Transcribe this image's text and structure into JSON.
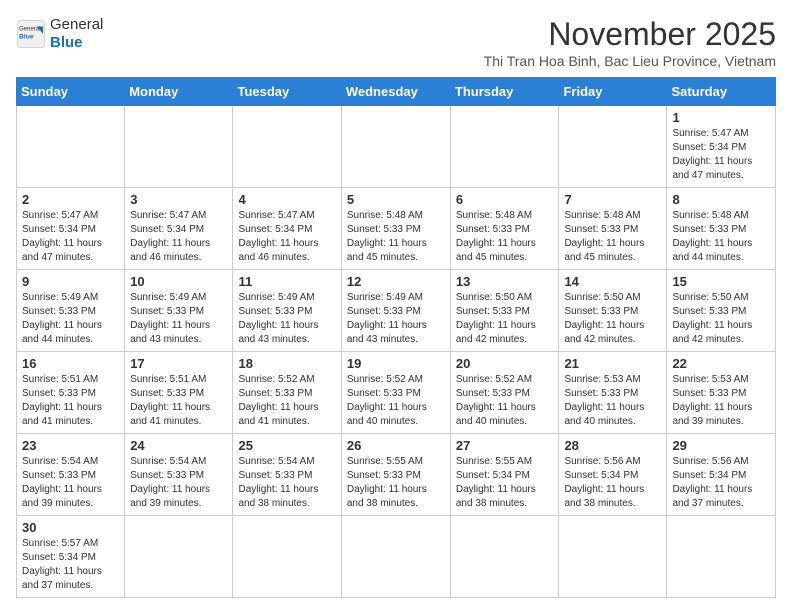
{
  "header": {
    "logo_general": "General",
    "logo_blue": "Blue",
    "month_title": "November 2025",
    "location": "Thi Tran Hoa Binh, Bac Lieu Province, Vietnam"
  },
  "weekdays": [
    "Sunday",
    "Monday",
    "Tuesday",
    "Wednesday",
    "Thursday",
    "Friday",
    "Saturday"
  ],
  "weeks": [
    [
      {
        "day": "",
        "info": ""
      },
      {
        "day": "",
        "info": ""
      },
      {
        "day": "",
        "info": ""
      },
      {
        "day": "",
        "info": ""
      },
      {
        "day": "",
        "info": ""
      },
      {
        "day": "",
        "info": ""
      },
      {
        "day": "1",
        "info": "Sunrise: 5:47 AM\nSunset: 5:34 PM\nDaylight: 11 hours\nand 47 minutes."
      }
    ],
    [
      {
        "day": "2",
        "info": "Sunrise: 5:47 AM\nSunset: 5:34 PM\nDaylight: 11 hours\nand 47 minutes."
      },
      {
        "day": "3",
        "info": "Sunrise: 5:47 AM\nSunset: 5:34 PM\nDaylight: 11 hours\nand 46 minutes."
      },
      {
        "day": "4",
        "info": "Sunrise: 5:47 AM\nSunset: 5:34 PM\nDaylight: 11 hours\nand 46 minutes."
      },
      {
        "day": "5",
        "info": "Sunrise: 5:48 AM\nSunset: 5:33 PM\nDaylight: 11 hours\nand 45 minutes."
      },
      {
        "day": "6",
        "info": "Sunrise: 5:48 AM\nSunset: 5:33 PM\nDaylight: 11 hours\nand 45 minutes."
      },
      {
        "day": "7",
        "info": "Sunrise: 5:48 AM\nSunset: 5:33 PM\nDaylight: 11 hours\nand 45 minutes."
      },
      {
        "day": "8",
        "info": "Sunrise: 5:48 AM\nSunset: 5:33 PM\nDaylight: 11 hours\nand 44 minutes."
      }
    ],
    [
      {
        "day": "9",
        "info": "Sunrise: 5:49 AM\nSunset: 5:33 PM\nDaylight: 11 hours\nand 44 minutes."
      },
      {
        "day": "10",
        "info": "Sunrise: 5:49 AM\nSunset: 5:33 PM\nDaylight: 11 hours\nand 43 minutes."
      },
      {
        "day": "11",
        "info": "Sunrise: 5:49 AM\nSunset: 5:33 PM\nDaylight: 11 hours\nand 43 minutes."
      },
      {
        "day": "12",
        "info": "Sunrise: 5:49 AM\nSunset: 5:33 PM\nDaylight: 11 hours\nand 43 minutes."
      },
      {
        "day": "13",
        "info": "Sunrise: 5:50 AM\nSunset: 5:33 PM\nDaylight: 11 hours\nand 42 minutes."
      },
      {
        "day": "14",
        "info": "Sunrise: 5:50 AM\nSunset: 5:33 PM\nDaylight: 11 hours\nand 42 minutes."
      },
      {
        "day": "15",
        "info": "Sunrise: 5:50 AM\nSunset: 5:33 PM\nDaylight: 11 hours\nand 42 minutes."
      }
    ],
    [
      {
        "day": "16",
        "info": "Sunrise: 5:51 AM\nSunset: 5:33 PM\nDaylight: 11 hours\nand 41 minutes."
      },
      {
        "day": "17",
        "info": "Sunrise: 5:51 AM\nSunset: 5:33 PM\nDaylight: 11 hours\nand 41 minutes."
      },
      {
        "day": "18",
        "info": "Sunrise: 5:52 AM\nSunset: 5:33 PM\nDaylight: 11 hours\nand 41 minutes."
      },
      {
        "day": "19",
        "info": "Sunrise: 5:52 AM\nSunset: 5:33 PM\nDaylight: 11 hours\nand 40 minutes."
      },
      {
        "day": "20",
        "info": "Sunrise: 5:52 AM\nSunset: 5:33 PM\nDaylight: 11 hours\nand 40 minutes."
      },
      {
        "day": "21",
        "info": "Sunrise: 5:53 AM\nSunset: 5:33 PM\nDaylight: 11 hours\nand 40 minutes."
      },
      {
        "day": "22",
        "info": "Sunrise: 5:53 AM\nSunset: 5:33 PM\nDaylight: 11 hours\nand 39 minutes."
      }
    ],
    [
      {
        "day": "23",
        "info": "Sunrise: 5:54 AM\nSunset: 5:33 PM\nDaylight: 11 hours\nand 39 minutes."
      },
      {
        "day": "24",
        "info": "Sunrise: 5:54 AM\nSunset: 5:33 PM\nDaylight: 11 hours\nand 39 minutes."
      },
      {
        "day": "25",
        "info": "Sunrise: 5:54 AM\nSunset: 5:33 PM\nDaylight: 11 hours\nand 38 minutes."
      },
      {
        "day": "26",
        "info": "Sunrise: 5:55 AM\nSunset: 5:33 PM\nDaylight: 11 hours\nand 38 minutes."
      },
      {
        "day": "27",
        "info": "Sunrise: 5:55 AM\nSunset: 5:34 PM\nDaylight: 11 hours\nand 38 minutes."
      },
      {
        "day": "28",
        "info": "Sunrise: 5:56 AM\nSunset: 5:34 PM\nDaylight: 11 hours\nand 38 minutes."
      },
      {
        "day": "29",
        "info": "Sunrise: 5:56 AM\nSunset: 5:34 PM\nDaylight: 11 hours\nand 37 minutes."
      }
    ],
    [
      {
        "day": "30",
        "info": "Sunrise: 5:57 AM\nSunset: 5:34 PM\nDaylight: 11 hours\nand 37 minutes."
      },
      {
        "day": "",
        "info": ""
      },
      {
        "day": "",
        "info": ""
      },
      {
        "day": "",
        "info": ""
      },
      {
        "day": "",
        "info": ""
      },
      {
        "day": "",
        "info": ""
      },
      {
        "day": "",
        "info": ""
      }
    ]
  ]
}
